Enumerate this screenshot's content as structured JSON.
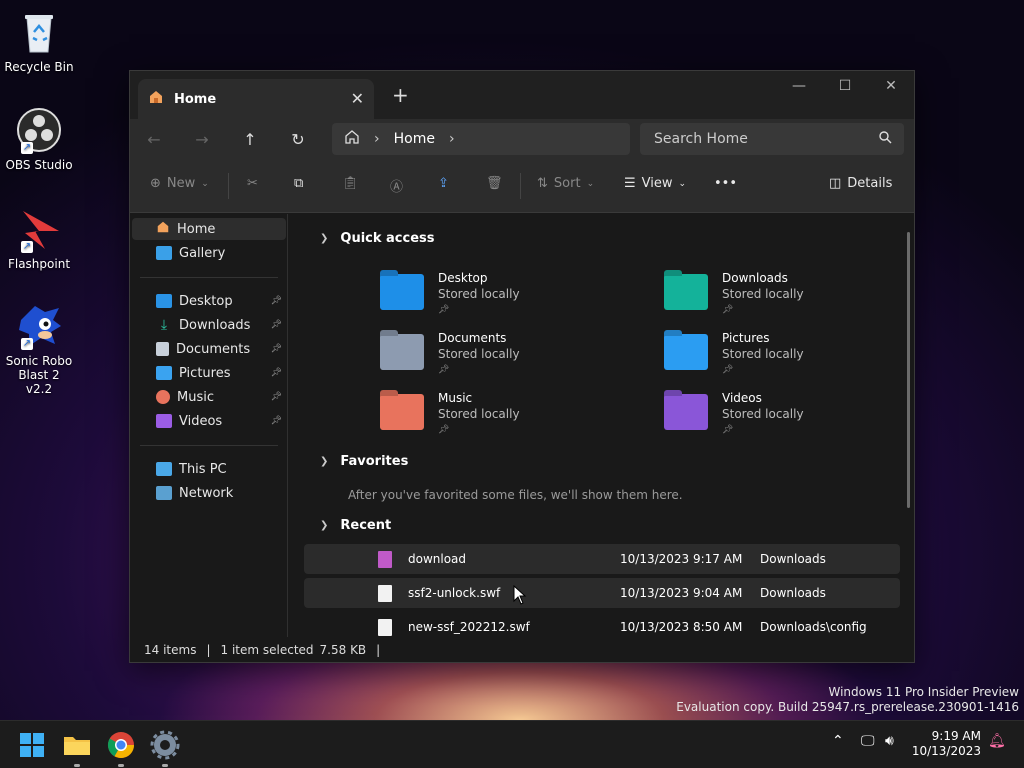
{
  "desktop": {
    "icons": [
      {
        "label": "Recycle Bin",
        "icon": "recycle-bin-icon"
      },
      {
        "label": "OBS Studio",
        "icon": "obs-icon"
      },
      {
        "label": "Flashpoint",
        "icon": "flashpoint-icon"
      },
      {
        "label": "Sonic Robo Blast 2 v2.2",
        "icon": "sonic-icon"
      }
    ]
  },
  "window": {
    "tab_title": "Home",
    "breadcrumb": {
      "current": "Home"
    },
    "search_placeholder": "Search Home",
    "toolbar": {
      "new_label": "New",
      "sort_label": "Sort",
      "view_label": "View",
      "more_label": "•••",
      "details_label": "Details"
    },
    "sidebar": {
      "top": [
        {
          "label": "Home",
          "selected": true
        },
        {
          "label": "Gallery"
        }
      ],
      "pinned": [
        {
          "label": "Desktop"
        },
        {
          "label": "Downloads"
        },
        {
          "label": "Documents"
        },
        {
          "label": "Pictures"
        },
        {
          "label": "Music"
        },
        {
          "label": "Videos"
        }
      ],
      "bottom": [
        {
          "label": "This PC"
        },
        {
          "label": "Network"
        }
      ]
    },
    "quick_access": {
      "title": "Quick access",
      "items": [
        {
          "name": "Desktop",
          "status": "Stored locally",
          "color": "#1e8fe8"
        },
        {
          "name": "Downloads",
          "status": "Stored locally",
          "color": "#14b29a"
        },
        {
          "name": "Documents",
          "status": "Stored locally",
          "color": "#8d9bb0"
        },
        {
          "name": "Pictures",
          "status": "Stored locally",
          "color": "#2b9df2"
        },
        {
          "name": "Music",
          "status": "Stored locally",
          "color": "#e8735d"
        },
        {
          "name": "Videos",
          "status": "Stored locally",
          "color": "#8a56d8"
        }
      ]
    },
    "favorites": {
      "title": "Favorites",
      "note": "After you've favorited some files, we'll show them here."
    },
    "recent": {
      "title": "Recent",
      "files": [
        {
          "name": "download",
          "date": "10/13/2023 9:17 AM",
          "location": "Downloads"
        },
        {
          "name": "ssf2-unlock.swf",
          "date": "10/13/2023 9:04 AM",
          "location": "Downloads"
        },
        {
          "name": "new-ssf_202212.swf",
          "date": "10/13/2023 8:50 AM",
          "location": "Downloads\\config"
        }
      ]
    },
    "status": {
      "items": "14 items",
      "selection": "1 item selected",
      "size": "7.58 KB"
    }
  },
  "watermark": {
    "line1": "Windows 11 Pro Insider Preview",
    "line2": "Evaluation copy. Build 25947.rs_prerelease.230901-1416"
  },
  "taskbar": {
    "time": "9:19 AM",
    "date": "10/13/2023"
  }
}
